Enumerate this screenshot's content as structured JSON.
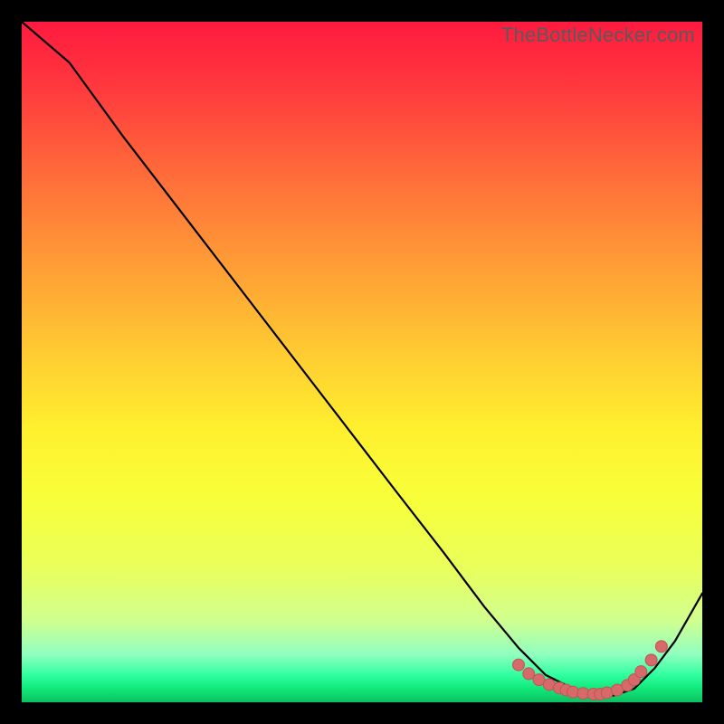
{
  "watermark": "TheBottleNecker.com",
  "chart_data": {
    "type": "line",
    "title": "",
    "xlabel": "",
    "ylabel": "",
    "xlim": [
      0,
      100
    ],
    "ylim": [
      0,
      100
    ],
    "series": [
      {
        "name": "curve",
        "x": [
          0,
          7,
          15,
          25,
          35,
          45,
          55,
          62,
          68,
          73,
          77,
          81,
          84,
          87,
          90,
          93,
          96,
          100
        ],
        "y": [
          100,
          94,
          83,
          70,
          57,
          44,
          31,
          22,
          14,
          8,
          4,
          2,
          1,
          1,
          2,
          5,
          9,
          16
        ]
      }
    ],
    "points": {
      "name": "cluster",
      "color": "#e46a6a",
      "x": [
        73,
        74.5,
        76,
        77.5,
        79,
        80,
        81,
        82.5,
        84,
        85,
        86,
        87.5,
        89,
        90,
        91,
        92.5,
        94
      ],
      "y": [
        5.5,
        4.2,
        3.3,
        2.6,
        2.1,
        1.8,
        1.5,
        1.3,
        1.2,
        1.2,
        1.4,
        1.8,
        2.5,
        3.3,
        4.5,
        6.2,
        8.2
      ]
    },
    "grid": false,
    "legend": "none"
  },
  "colors": {
    "curve": "#000000",
    "point_fill": "#d66a6a",
    "point_stroke": "#c45252"
  }
}
